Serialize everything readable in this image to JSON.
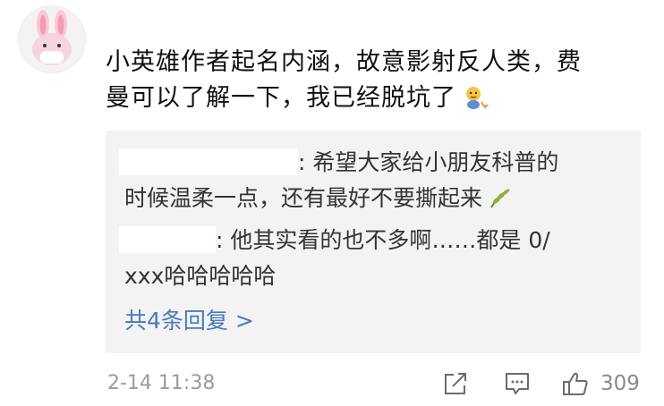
{
  "comment": {
    "text_line1": "小英雄作者起名内涵，故意影射反人类，费",
    "text_line2": "曼可以了解一下，我已经脱坑了"
  },
  "replies": [
    {
      "line1": ": 希望大家给小朋友科普的",
      "line2": "时候温柔一点，还有最好不要撕起来"
    },
    {
      "line1": ": 他其实看的也不多啊……都是 0/",
      "line2": "xxx哈哈哈哈哈"
    }
  ],
  "more_replies_label": "共4条回复 >",
  "footer": {
    "timestamp": "2-14 11:38",
    "like_count": "309"
  },
  "colors": {
    "link": "#4a7ab8",
    "reply_bg": "#f3f3f3",
    "muted": "#9b9b9b"
  }
}
